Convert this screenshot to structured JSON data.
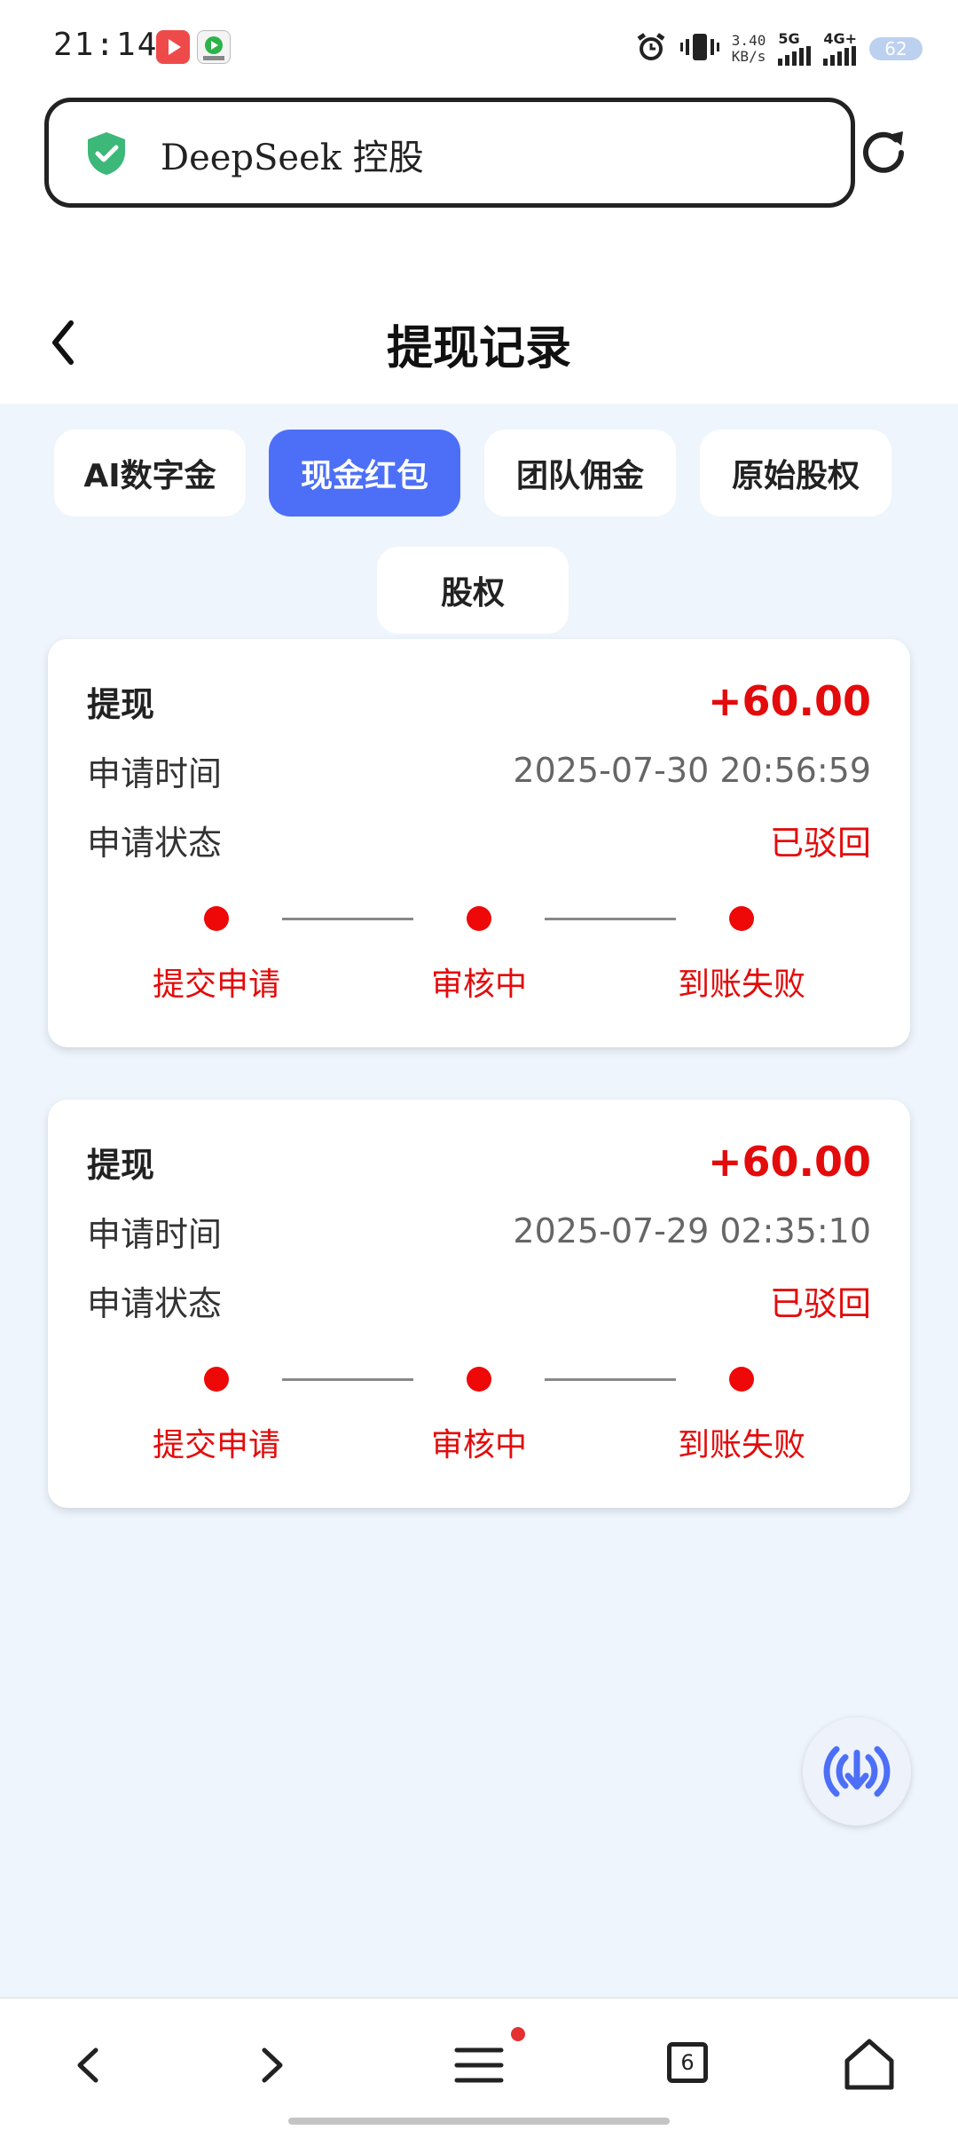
{
  "status_bar": {
    "time": "21:14",
    "net_speed_value": "3.40",
    "net_speed_unit": "KB/s",
    "sim1_label": "5G",
    "sim2_label": "4G+",
    "battery": "62"
  },
  "browser": {
    "url_text": "DeepSeek 控股",
    "tab_count": "6"
  },
  "header": {
    "title": "提现记录"
  },
  "tabs": [
    {
      "label": "AI数字金",
      "active": false
    },
    {
      "label": "现金红包",
      "active": true
    },
    {
      "label": "团队佣金",
      "active": false
    },
    {
      "label": "原始股权",
      "active": false
    },
    {
      "label": "股权",
      "active": false
    }
  ],
  "records": [
    {
      "type_label": "提现",
      "amount": "+60.00",
      "time_label": "申请时间",
      "time_value": "2025-07-30 20:56:59",
      "status_label": "申请状态",
      "status_value": "已驳回",
      "steps": [
        "提交申请",
        "审核中",
        "到账失败"
      ]
    },
    {
      "type_label": "提现",
      "amount": "+60.00",
      "time_label": "申请时间",
      "time_value": "2025-07-29 02:35:10",
      "status_label": "申请状态",
      "status_value": "已驳回",
      "steps": [
        "提交申请",
        "审核中",
        "到账失败"
      ]
    }
  ],
  "icons": {
    "security": "shield-check-icon",
    "reload": "reload-icon",
    "back": "back-arrow-icon",
    "float": "download-broadcast-icon",
    "nav_back": "chevron-left-icon",
    "nav_forward": "chevron-right-icon",
    "menu": "menu-icon",
    "home": "home-icon"
  },
  "colors": {
    "accent": "#4d6ff7",
    "danger": "#e30b0b",
    "background": "#eef5fd",
    "shield": "#3cb878"
  }
}
